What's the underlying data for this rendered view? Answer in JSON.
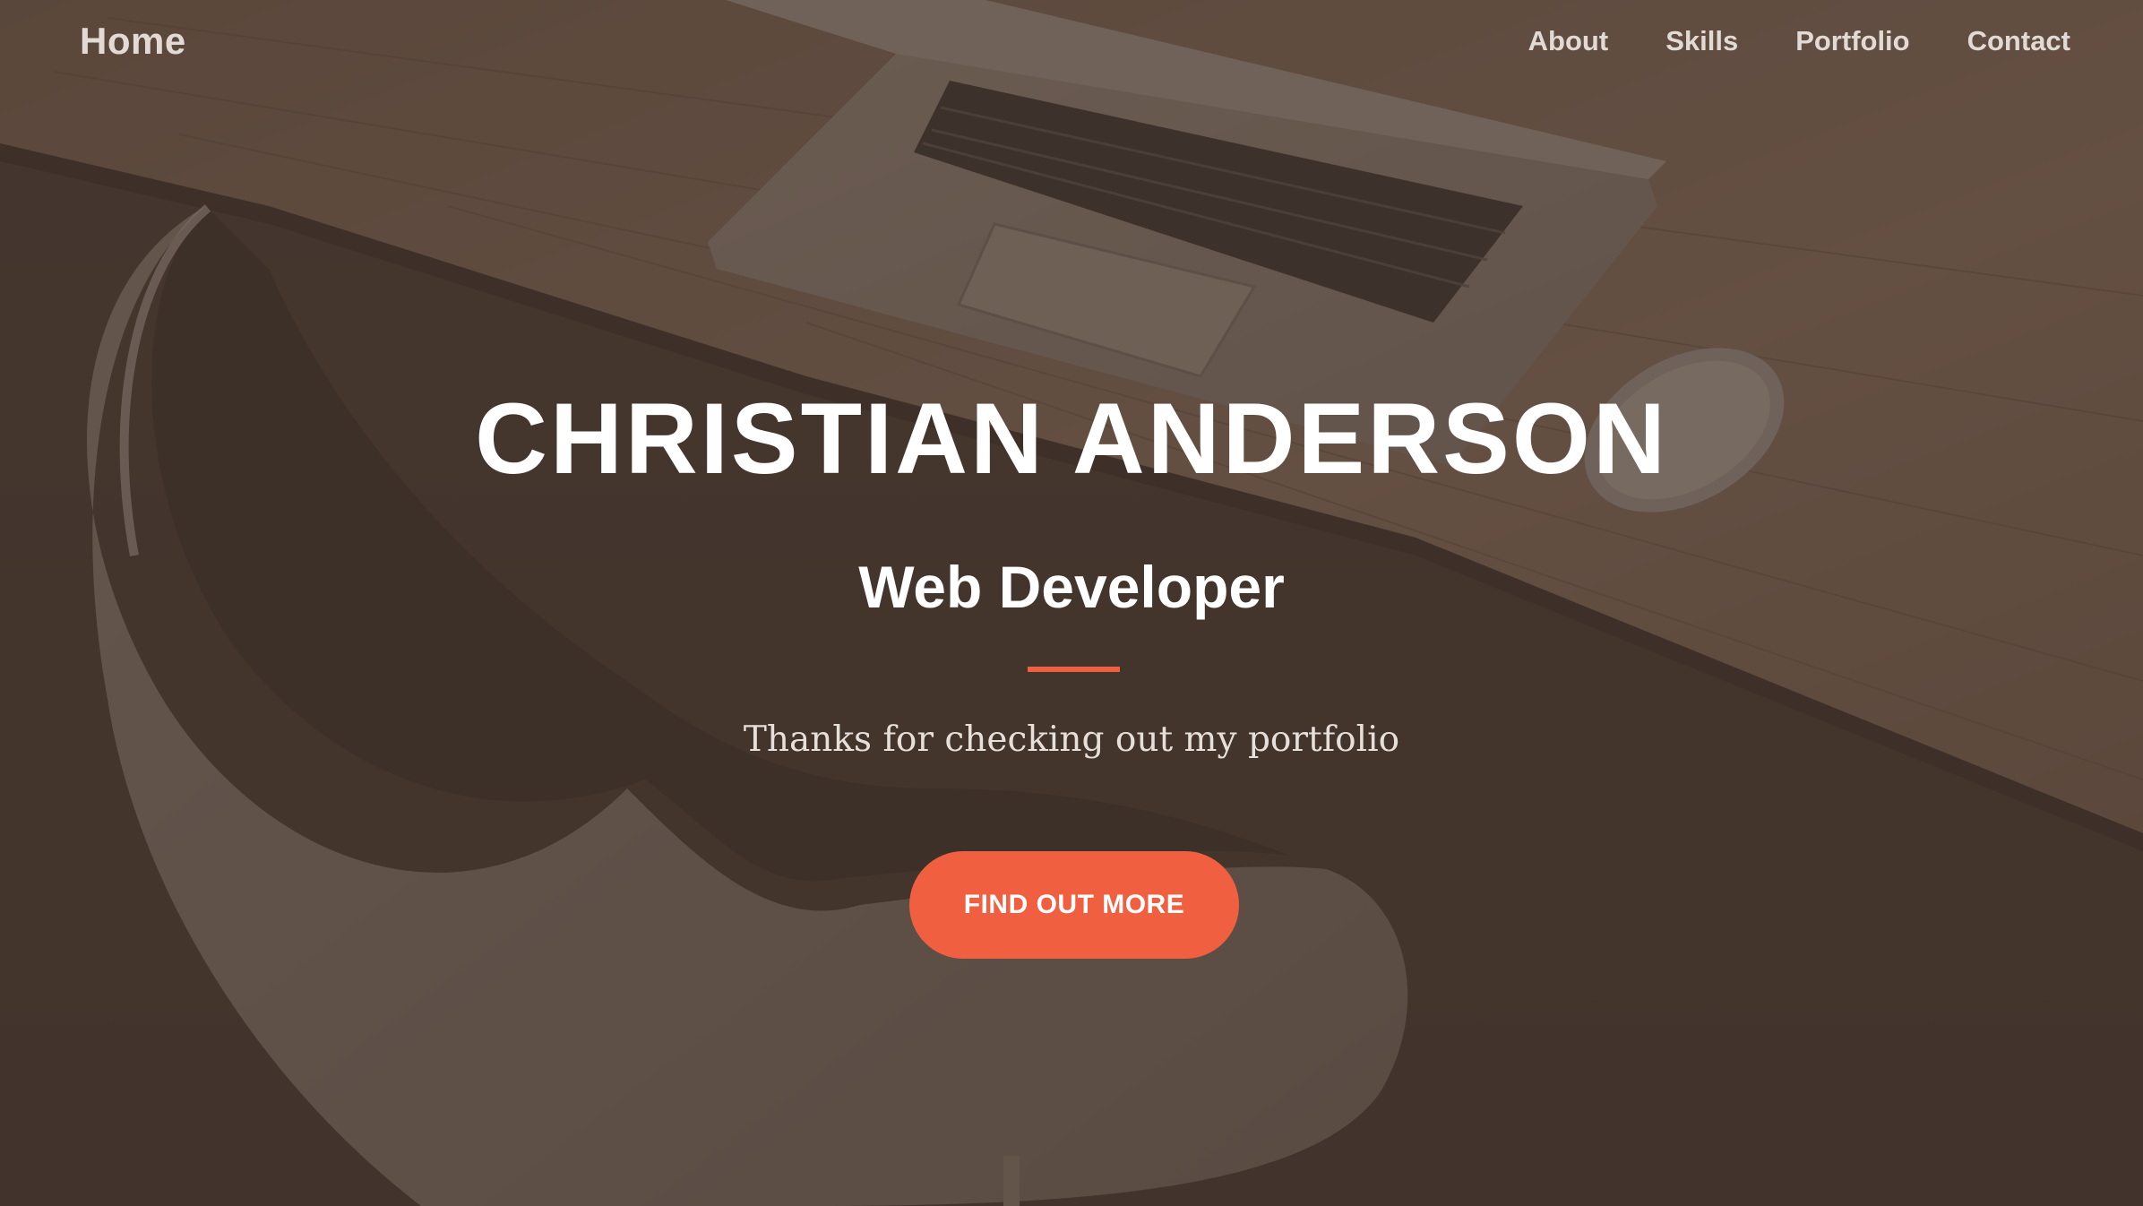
{
  "nav": {
    "brand": "Home",
    "links": [
      {
        "label": "About"
      },
      {
        "label": "Skills"
      },
      {
        "label": "Portfolio"
      },
      {
        "label": "Contact"
      }
    ]
  },
  "hero": {
    "name": "CHRISTIAN ANDERSON",
    "role": "Web Developer",
    "tagline": "Thanks for checking out my portfolio",
    "cta_label": "FIND OUT MORE"
  },
  "colors": {
    "accent": "#f05f40",
    "overlay": "#4b3d35",
    "text": "#ffffff",
    "nav_text": "#e2dad5"
  }
}
